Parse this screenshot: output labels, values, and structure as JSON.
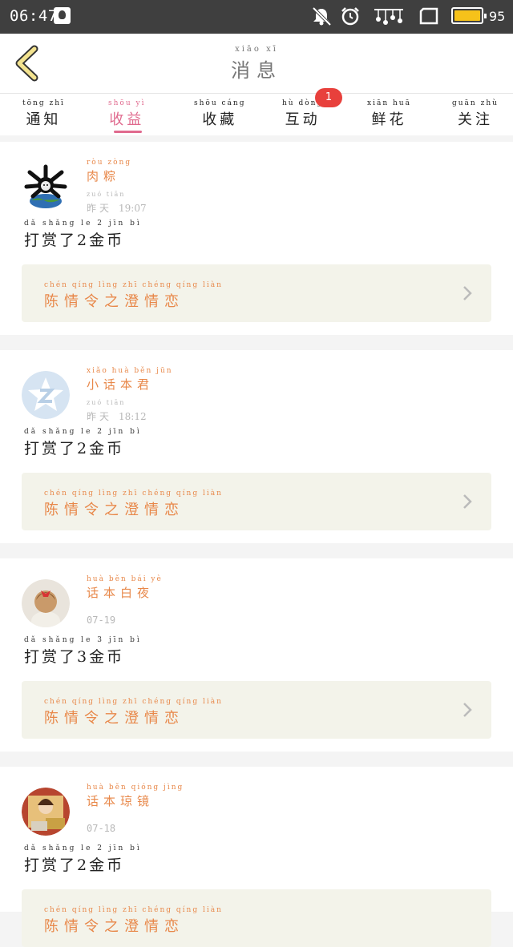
{
  "status_bar": {
    "time": "06:47",
    "battery": "95"
  },
  "header": {
    "title_pinyin": "xiāo xī",
    "title": "消息"
  },
  "tabs": [
    {
      "pinyin": "tōng zhī",
      "label": "通知"
    },
    {
      "pinyin": "shōu yì",
      "label": "收益"
    },
    {
      "pinyin": "shōu cáng",
      "label": "收藏"
    },
    {
      "pinyin": "hù dòng",
      "label": "互动"
    },
    {
      "pinyin": "xiān huā",
      "label": "鲜花"
    },
    {
      "pinyin": "guān zhù",
      "label": "关注"
    }
  ],
  "interaction_badge": "1",
  "accent_color": "#e06a8e",
  "name_color": "#e8884a",
  "items": [
    {
      "name_pinyin": "ròu zòng",
      "name": "肉粽",
      "date_pinyin": "zuó tiān",
      "date": "昨天",
      "time": "19:07",
      "reward_pinyin": "dǎ shǎng le  2  jīn bì",
      "reward": "打赏了2金币",
      "book_pinyin": "chén qíng lìng zhī chéng qíng liàn",
      "book": "陈情令之澄情恋"
    },
    {
      "name_pinyin": "xiǎo huà běn jūn",
      "name": "小话本君",
      "date_pinyin": "zuó tiān",
      "date": "昨天",
      "time": "18:12",
      "reward_pinyin": "dǎ shǎng le  2  jīn bì",
      "reward": "打赏了2金币",
      "book_pinyin": "chén qíng lìng zhī chéng qíng liàn",
      "book": "陈情令之澄情恋"
    },
    {
      "name_pinyin": "huà běn bái yè",
      "name": "话本白夜",
      "date": "07-19",
      "reward_pinyin": "dǎ shǎng le  3  jīn bì",
      "reward": "打赏了3金币",
      "book_pinyin": "chén qíng lìng zhī chéng qíng liàn",
      "book": "陈情令之澄情恋"
    },
    {
      "name_pinyin": "huà běn qióng jìng",
      "name": "话本琼镜",
      "date": "07-18",
      "reward_pinyin": "dǎ shǎng le  2  jīn bì",
      "reward": "打赏了2金币",
      "book_pinyin": "chén qíng lìng zhī chéng qíng liàn",
      "book": "陈情令之澄情恋"
    }
  ]
}
